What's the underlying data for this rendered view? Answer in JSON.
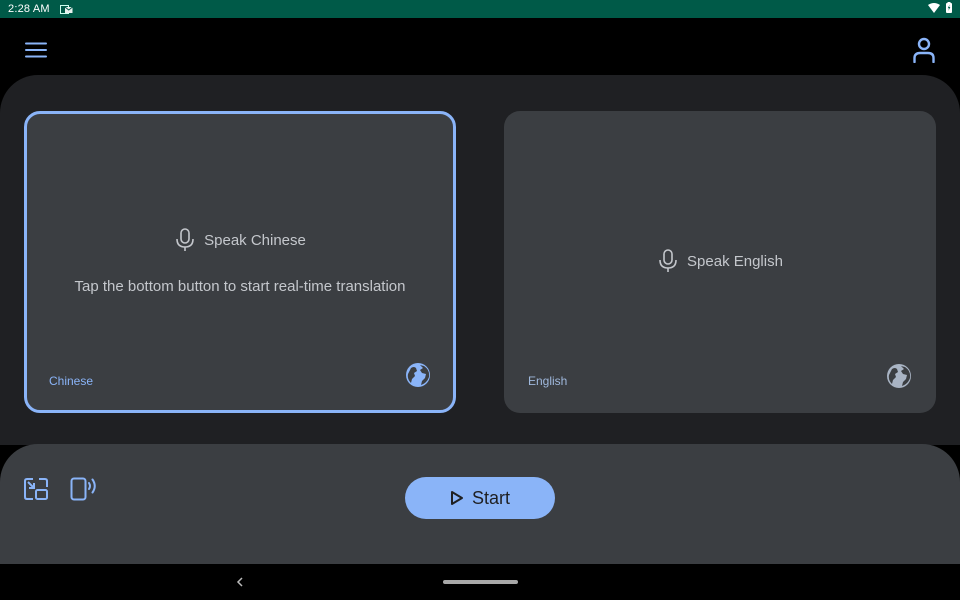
{
  "status_bar": {
    "time": "2:28 AM",
    "notification_icon": "mail-notification-icon",
    "wifi_icon": "wifi-icon",
    "battery_icon": "battery-charging-icon"
  },
  "app_bar": {
    "menu_icon": "hamburger-menu-icon",
    "profile_icon": "person-icon"
  },
  "source_panel": {
    "speak_label": "Speak Chinese",
    "hint": "Tap the bottom button to start real-time translation",
    "language": "Chinese",
    "selected": true
  },
  "target_panel": {
    "speak_label": "Speak English",
    "language": "English",
    "selected": false
  },
  "bottom_bar": {
    "start_label": "Start",
    "tools": [
      "picture-in-picture-icon",
      "phone-speaker-icon"
    ]
  },
  "colors": {
    "accent": "#8ab4f8",
    "status_bar": "#005a48",
    "panel_bg": "#1f2023",
    "card_bg": "#3b3e42"
  }
}
